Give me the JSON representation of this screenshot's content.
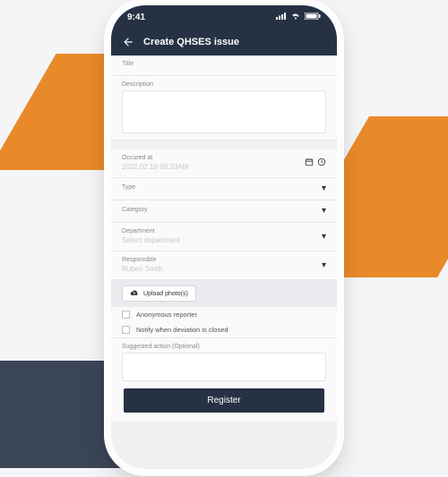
{
  "status": {
    "time": "9:41",
    "signal_icon": "signal-icon",
    "wifi_icon": "wifi-icon",
    "battery_icon": "battery-icon"
  },
  "header": {
    "title": "Create QHSES issue"
  },
  "form": {
    "title_label": "Title",
    "description_label": "Description",
    "occurred_label": "Occured at",
    "occurred_value": "2022.02.18 08:33AM",
    "type_label": "Type",
    "category_label": "Category",
    "department_label": "Department",
    "department_placeholder": "Select department",
    "responsible_label": "Responsible",
    "responsible_value": "Ruben Smith",
    "upload_label": "Upload photo(s)",
    "anonymous_label": "Anonymous reporter",
    "notify_label": "Notify when deviation is closed",
    "suggested_label": "Suggested action (Optional)",
    "register_label": "Register"
  },
  "colors": {
    "brand_dark": "#263244",
    "accent_orange": "#e98a2a"
  }
}
